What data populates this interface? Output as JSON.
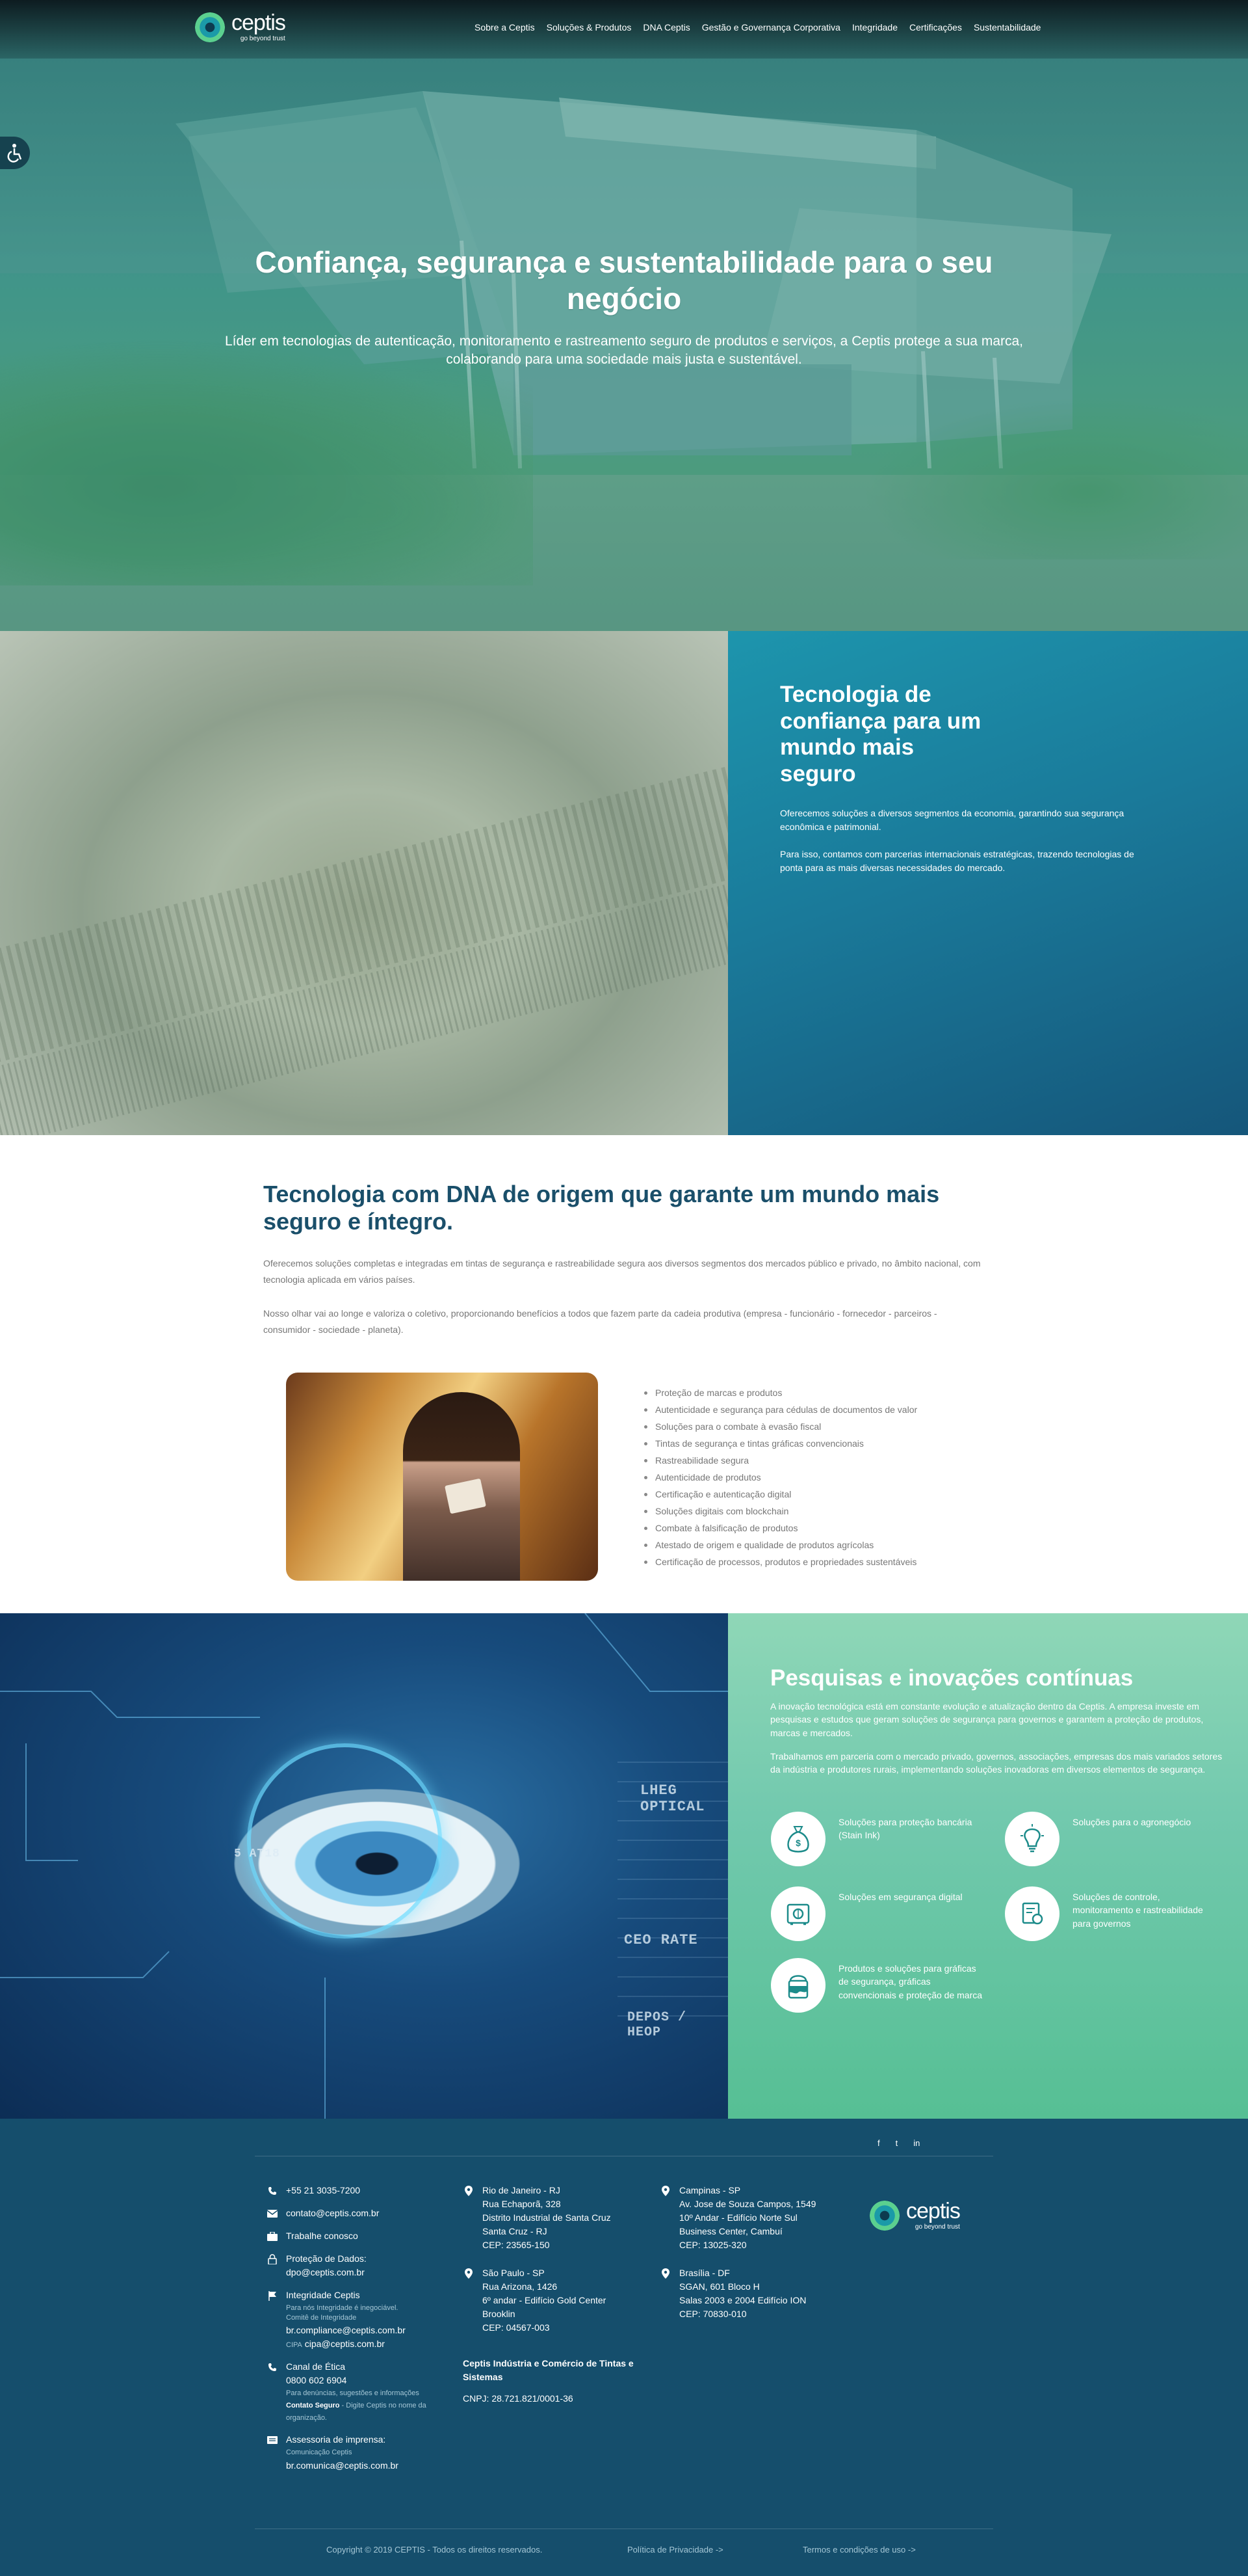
{
  "header": {
    "logo_brand": "ceptis",
    "logo_tagline": "go beyond trust",
    "nav": [
      "Sobre a Ceptis",
      "Soluções & Produtos",
      "DNA Ceptis",
      "Gestão e Governança Corporativa",
      "Integridade",
      "Certificações",
      "Sustentabilidade"
    ]
  },
  "hero": {
    "title": "Confiança, segurança e sustentabilidade para o seu negócio",
    "subtitle": "Líder em tecnologias de autenticação, monitoramento e rastreamento seguro de produtos e serviços, a Ceptis protege a sua marca, colaborando para uma sociedade mais justa e sustentável."
  },
  "trust": {
    "title": "Tecnologia de confiança para um mundo mais seguro",
    "p1": "Oferecemos soluções a diversos segmentos da economia, garantindo sua segurança econômica e patrimonial.",
    "p2": "Para isso, contamos com parcerias internacionais estratégicas, trazendo tecnologias de ponta para as mais diversas necessidades do mercado."
  },
  "dna": {
    "title": "Tecnologia com DNA de origem que garante um mundo mais seguro e íntegro.",
    "p1": "Oferecemos soluções completas e integradas em tintas de segurança e rastreabilidade segura aos diversos segmentos dos mercados público e privado, no âmbito nacional, com tecnologia aplicada em vários países.",
    "p2": "Nosso olhar vai ao longe e valoriza o coletivo, proporcionando benefícios a todos que fazem parte da cadeia produtiva (empresa - funcionário - fornecedor - parceiros - consumidor - sociedade - planeta).",
    "items": [
      "Proteção de marcas e produtos",
      "Autenticidade e segurança para cédulas de documentos de valor",
      "Soluções para o combate à evasão fiscal",
      "Tintas de segurança e tintas gráficas convencionais",
      "Rastreabilidade segura",
      "Autenticidade de produtos",
      "Certificação e autenticação digital",
      "Soluções digitais com blockchain",
      "Combate à falsificação de produtos",
      "Atestado de origem e qualidade de produtos agrícolas",
      "Certificação de processos, produtos e propriedades sustentáveis"
    ]
  },
  "research": {
    "title": "Pesquisas e inovações contínuas",
    "p1": "A inovação tecnológica está em constante evolução e atualização dentro da Ceptis. A empresa investe em pesquisas e estudos que geram soluções de segurança para governos e garantem a proteção de produtos, marcas e mercados.",
    "p2": "Trabalhamos em parceria com o mercado privado, governos, associações, empresas dos mais variados setores da indústria e produtores rurais, implementando soluções inovadoras em diversos elementos de segurança.",
    "solutions": [
      {
        "label": "Soluções para proteção bancária (Stain Ink)",
        "icon": "money-bag-icon"
      },
      {
        "label": "Soluções para o agronegócio",
        "icon": "lightbulb-icon"
      },
      {
        "label": "Soluções em segurança digital",
        "icon": "digital-safe-icon"
      },
      {
        "label": "Soluções de controle, monitoramento e rastreabilidade para governos",
        "icon": "document-seal-icon"
      },
      {
        "label": "Produtos e soluções para gráficas de segurança, gráficas convencionais e proteção de marca",
        "icon": "ink-can-icon"
      }
    ]
  },
  "footer": {
    "phone": "+55 21 3035-7200",
    "email": "contato@ceptis.com.br",
    "work": "Trabalhe conosco",
    "dpo_label": "Proteção de Dados:",
    "dpo_email": "dpo@ceptis.com.br",
    "integrity_title": "Integridade Ceptis",
    "integrity_line1": "Para nós Integridade é inegociável.",
    "integrity_line2": "Comitê de Integridade",
    "integrity_email": "br.compliance@ceptis.com.br",
    "cipa_label": "CIPA",
    "cipa_email": "cipa@ceptis.com.br",
    "ethics_title": "Canal de Ética",
    "ethics_phone": "0800 602 6904",
    "ethics_note1": "Para denúncias, sugestões e informações",
    "ethics_note_bold": "Contato Seguro",
    "ethics_note2": " - Digite Ceptis no nome da organização.",
    "press_title": "Assessoria de imprensa:",
    "press_sub": "Comunicação Ceptis",
    "press_email": "br.comunica@ceptis.com.br",
    "addr_rj": [
      "Rio de Janeiro - RJ",
      "Rua Echaporã, 328",
      "Distrito Industrial de Santa Cruz",
      "Santa Cruz - RJ",
      "CEP: 23565-150"
    ],
    "addr_sp": [
      "São Paulo - SP",
      "Rua Arizona, 1426",
      "6º andar - Edifício Gold Center",
      "Brooklin",
      "CEP: 04567-003"
    ],
    "addr_campinas": [
      "Campinas - SP",
      "Av. Jose de Souza Campos, 1549",
      "10º Andar - Edifício Norte Sul",
      "Business Center, Cambuí",
      "CEP: 13025-320"
    ],
    "addr_brasilia": [
      "Brasília - DF",
      "SGAN, 601 Bloco H",
      "Salas 2003 e 2004 Edifício ION",
      "CEP: 70830-010"
    ],
    "company": "Ceptis Indústria e Comércio de Tintas e Sistemas",
    "cnpj": "CNPJ: 28.721.821/0001-36",
    "copyright": "Copyright © 2019 CEPTIS - Todos os direitos reservados.",
    "privacy": "Política de Privacidade ->",
    "terms": "Termos e condições de uso ->",
    "social": [
      "f",
      "t",
      "in"
    ]
  }
}
